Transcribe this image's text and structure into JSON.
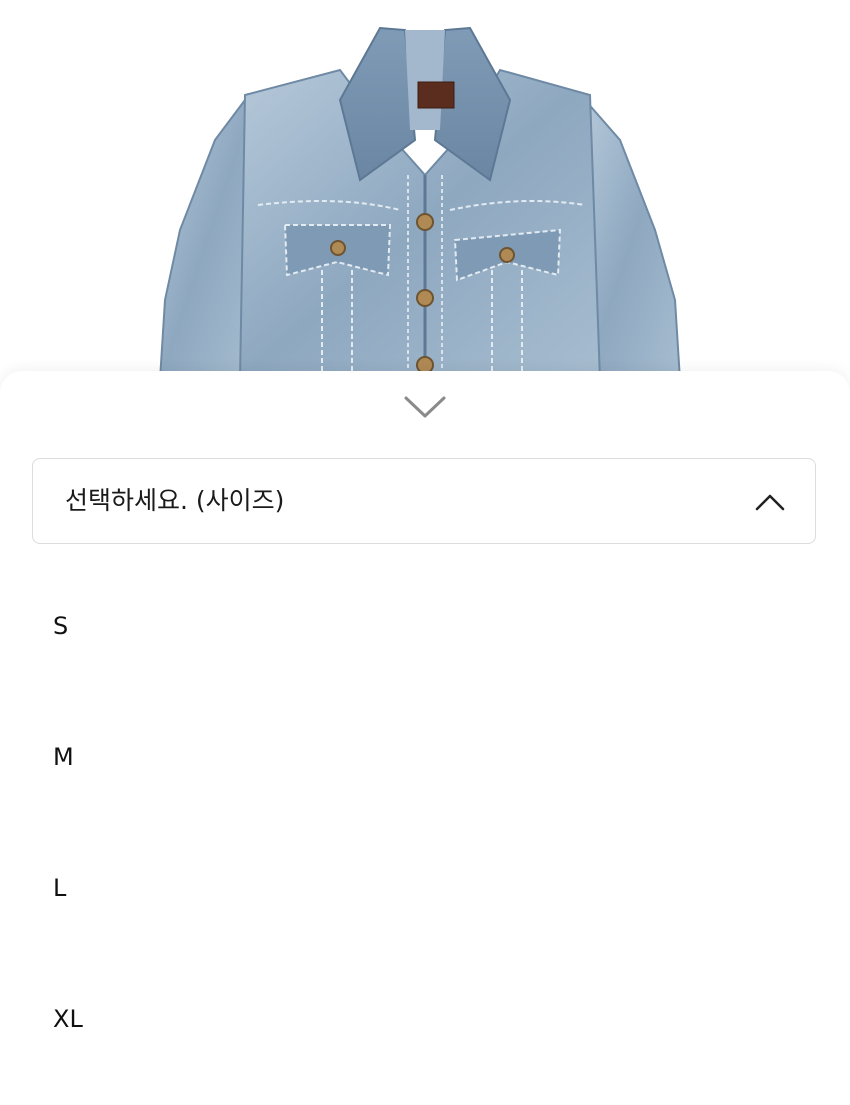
{
  "product": {
    "image_alt": "denim trucker jacket"
  },
  "sheet": {
    "collapse_icon": "chevron-down-icon"
  },
  "size_select": {
    "placeholder": "선택하세요. (사이즈)",
    "toggle_icon": "chevron-up-icon",
    "options": [
      "S",
      "M",
      "L",
      "XL"
    ]
  },
  "colors": {
    "denim_light": "#a9bfd3",
    "denim_mid": "#7f9bb6",
    "denim_dark": "#5d7894",
    "border": "#dcdcdc",
    "text": "#111111"
  }
}
